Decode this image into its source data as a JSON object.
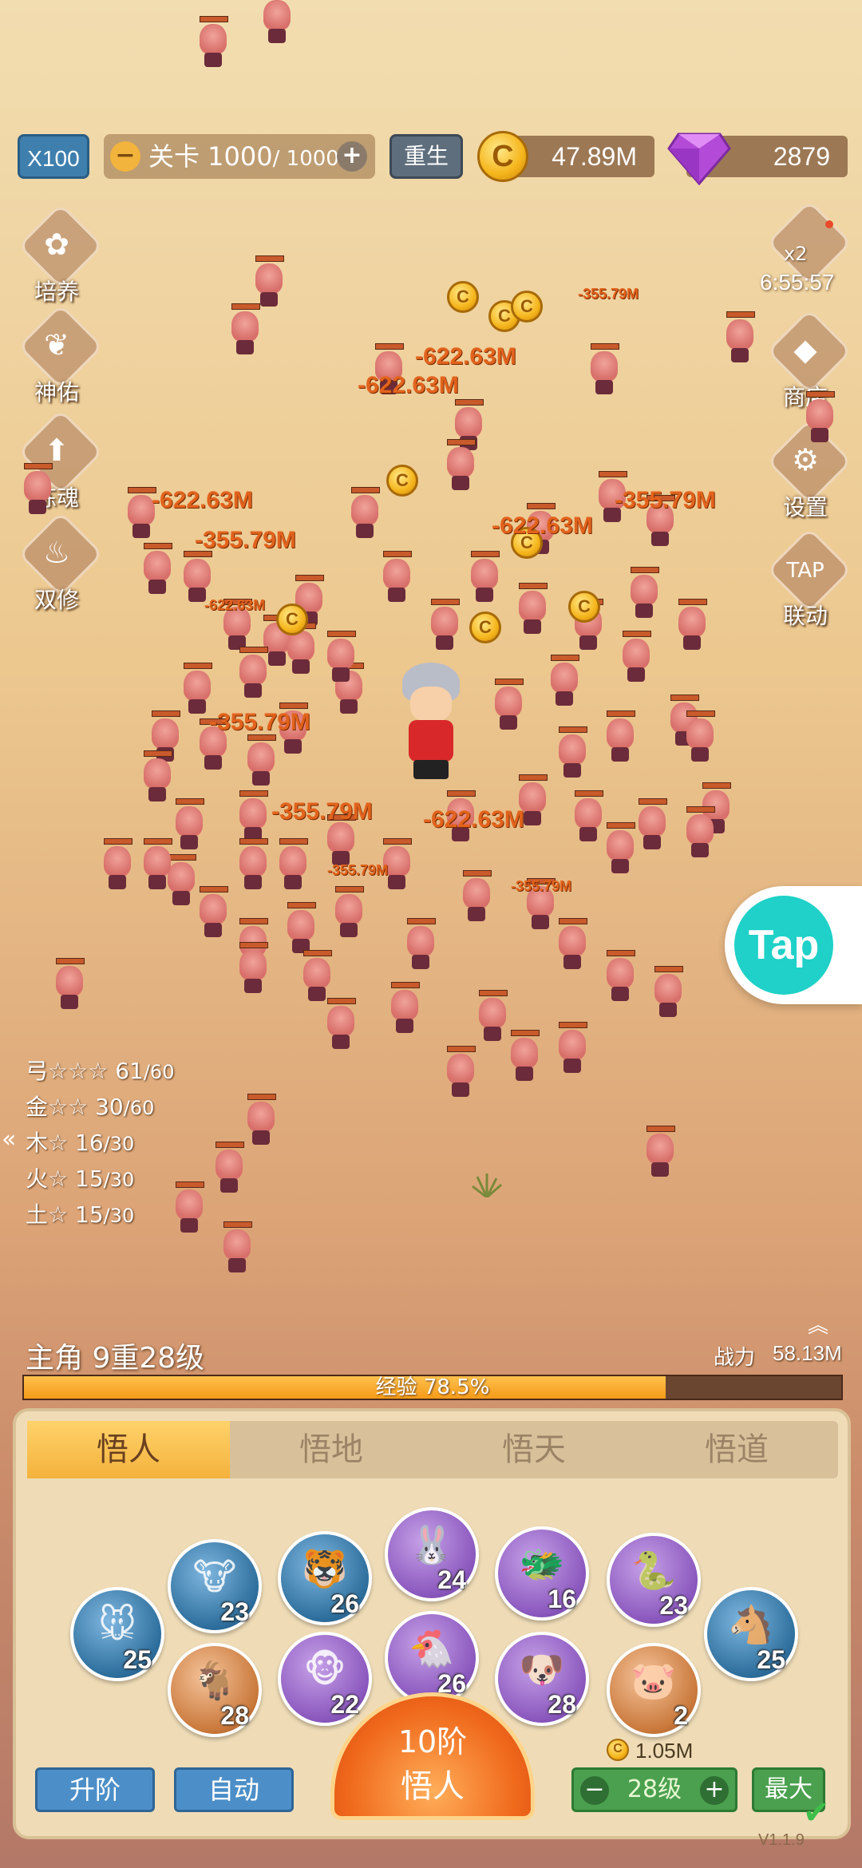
{
  "top_bar": {
    "speed_label": "X100",
    "stage_label": "关卡 1000",
    "stage_total": "/ 1000",
    "rebirth_label": "重生",
    "gold_value": "47.89M",
    "gem_value": "2879"
  },
  "left_menu": [
    {
      "label": "培养",
      "icon": "clover-icon"
    },
    {
      "label": "神佑",
      "icon": "wings-icon"
    },
    {
      "label": "炼魂",
      "icon": "arrow-up-icon"
    },
    {
      "label": "双修",
      "icon": "flame-icon"
    }
  ],
  "right_menu": {
    "bonus_multiplier": "x2",
    "bonus_timer": "6:55:57",
    "items": [
      {
        "label": "商店",
        "icon": "diamond-icon"
      },
      {
        "label": "设置",
        "icon": "gear-icon"
      },
      {
        "label": "联动",
        "icon": "taptap-icon"
      }
    ]
  },
  "damage_numbers": [
    "-622.63M",
    "-622.63M",
    "-622.63M",
    "-355.79M",
    "-355.79M",
    "-622.63M",
    "-355.79M",
    "-622.63M",
    "-355.79M",
    "-355.79M",
    "-622.63M",
    "-355.79M",
    "-355.79M"
  ],
  "tap_label": "Tap",
  "element_list": [
    {
      "text": "弓☆☆☆ 61",
      "max": "/60"
    },
    {
      "text": "金☆☆ 30",
      "max": "/60"
    },
    {
      "text": "木☆ 16",
      "max": "/30"
    },
    {
      "text": "火☆ 15",
      "max": "/30"
    },
    {
      "text": "土☆ 15",
      "max": "/30"
    }
  ],
  "status": {
    "hero_level": "主角 9重28级",
    "power_label": "战力",
    "power_value": "58.13M",
    "exp_label": "经验 78.5%",
    "exp_fraction": 0.785
  },
  "panel": {
    "tabs": [
      "悟人",
      "悟地",
      "悟天",
      "悟道"
    ],
    "active_tab": 0,
    "zodiac": [
      {
        "name": "rat",
        "level": "25",
        "color": "blue"
      },
      {
        "name": "ox",
        "level": "23",
        "color": "blue"
      },
      {
        "name": "tiger",
        "level": "26",
        "color": "blue"
      },
      {
        "name": "rabbit",
        "level": "24",
        "color": "purple"
      },
      {
        "name": "dragon",
        "level": "16",
        "color": "purple"
      },
      {
        "name": "snake",
        "level": "23",
        "color": "purple"
      },
      {
        "name": "horse",
        "level": "25",
        "color": "blue"
      },
      {
        "name": "goat",
        "level": "28",
        "color": "orange"
      },
      {
        "name": "monkey",
        "level": "22",
        "color": "purple"
      },
      {
        "name": "rooster",
        "level": "26",
        "color": "purple"
      },
      {
        "name": "dog",
        "level": "28",
        "color": "purple"
      },
      {
        "name": "pig",
        "level": "2",
        "color": "orange"
      }
    ],
    "advance_label": "升阶",
    "auto_label": "自动",
    "big_button_top": "10阶",
    "big_button_bottom": "悟人",
    "cost_value": "1.05M",
    "level_value": "28级",
    "max_label": "最大"
  },
  "version": "V1.1.9",
  "colors": {
    "accent": "#f4b23c",
    "blue": "#4c8fc8",
    "green": "#4aa04e",
    "damage": "#e2631d"
  }
}
